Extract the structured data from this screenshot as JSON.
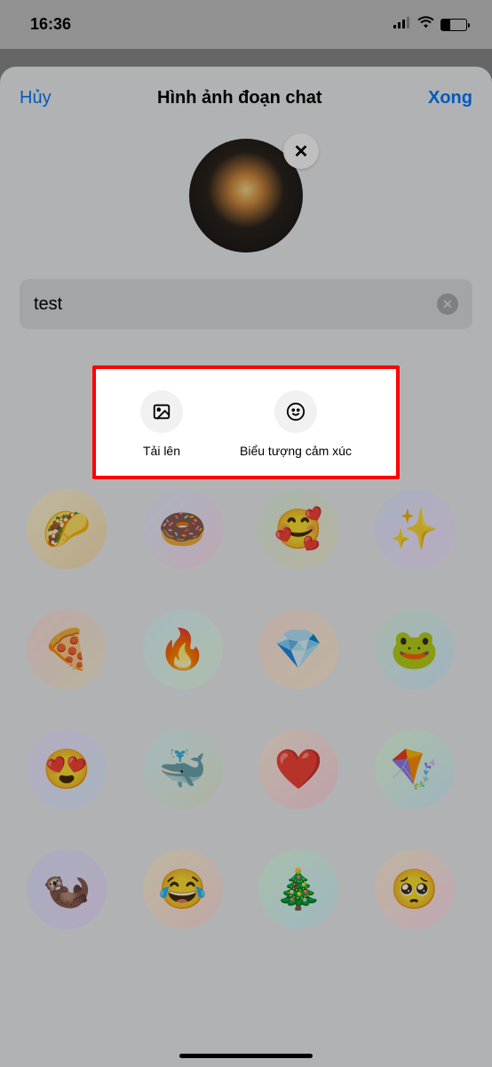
{
  "status": {
    "time": "16:36"
  },
  "sheet": {
    "cancel_label": "Hủy",
    "title": "Hình ảnh đoạn chat",
    "done_label": "Xong"
  },
  "avatar": {
    "close_symbol": "✕"
  },
  "input": {
    "value": "test",
    "clear_symbol": "✕"
  },
  "popup": {
    "upload_label": "Tải lên",
    "emoji_label": "Biểu tượng cảm xúc"
  },
  "emojis": [
    {
      "char": "🌮",
      "grad": "grad-1"
    },
    {
      "char": "🍩",
      "grad": "grad-2"
    },
    {
      "char": "🥰",
      "grad": "grad-3"
    },
    {
      "char": "✨",
      "grad": "grad-4"
    },
    {
      "char": "🍕",
      "grad": "grad-5"
    },
    {
      "char": "🔥",
      "grad": "grad-6"
    },
    {
      "char": "💎",
      "grad": "grad-7"
    },
    {
      "char": "🐸",
      "grad": "grad-8"
    },
    {
      "char": "😍",
      "grad": "grad-9"
    },
    {
      "char": "🐳",
      "grad": "grad-10"
    },
    {
      "char": "❤️",
      "grad": "grad-11"
    },
    {
      "char": "🪁",
      "grad": "grad-12"
    },
    {
      "char": "🦦",
      "grad": "grad-13"
    },
    {
      "char": "😂",
      "grad": "grad-14"
    },
    {
      "char": "🎄",
      "grad": "grad-15"
    },
    {
      "char": "🥺",
      "grad": "grad-16"
    }
  ]
}
